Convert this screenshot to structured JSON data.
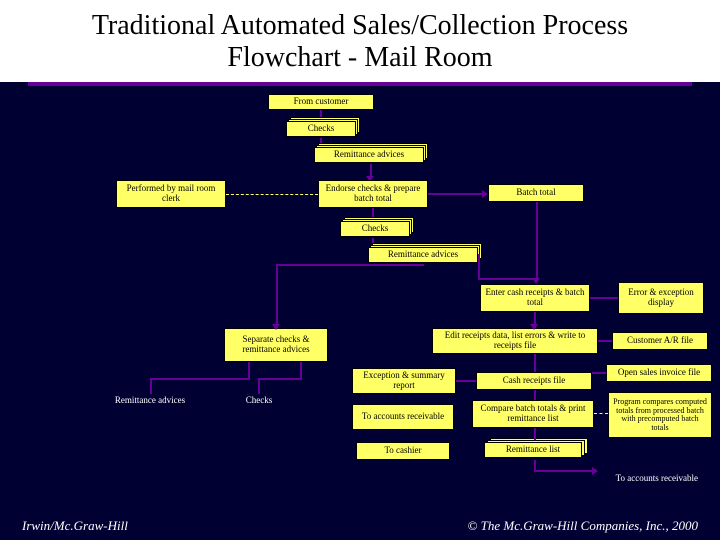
{
  "title": "Traditional Automated Sales/Collection Process Flowchart - Mail Room",
  "boxes": {
    "from_customer": "From customer",
    "checks1": "Checks",
    "remit1": "Remittance advices",
    "performed": "Performed by mail room clerk",
    "endorse": "Endorse checks & prepare batch total",
    "batch_total": "Batch total",
    "checks2": "Checks",
    "remit2": "Remittance advices",
    "enter": "Enter cash receipts & batch total",
    "error_disp": "Error & exception display",
    "separate": "Separate checks & remittance advices",
    "edit": "Edit receipts data, list errors & write to receipts file",
    "customer_ar": "Customer A/R file",
    "exception": "Exception & summary report",
    "cash_file": "Cash receipts file",
    "open_sales": "Open sales invoice file",
    "remit_adv_lbl": "Remittance advices",
    "checks_lbl": "Checks",
    "to_ar": "To accounts receivable",
    "compare": "Compare batch totals & print remittance list",
    "program": "Program compares computed totals from processed batch with precomputed batch totals",
    "to_cashier": "To cashier",
    "remit_list": "Remittance list",
    "to_ar2": "To accounts receivable"
  },
  "footer": {
    "left": "Irwin/Mc.Graw-Hill",
    "right": "© The Mc.Graw-Hill Companies, Inc., 2000"
  }
}
